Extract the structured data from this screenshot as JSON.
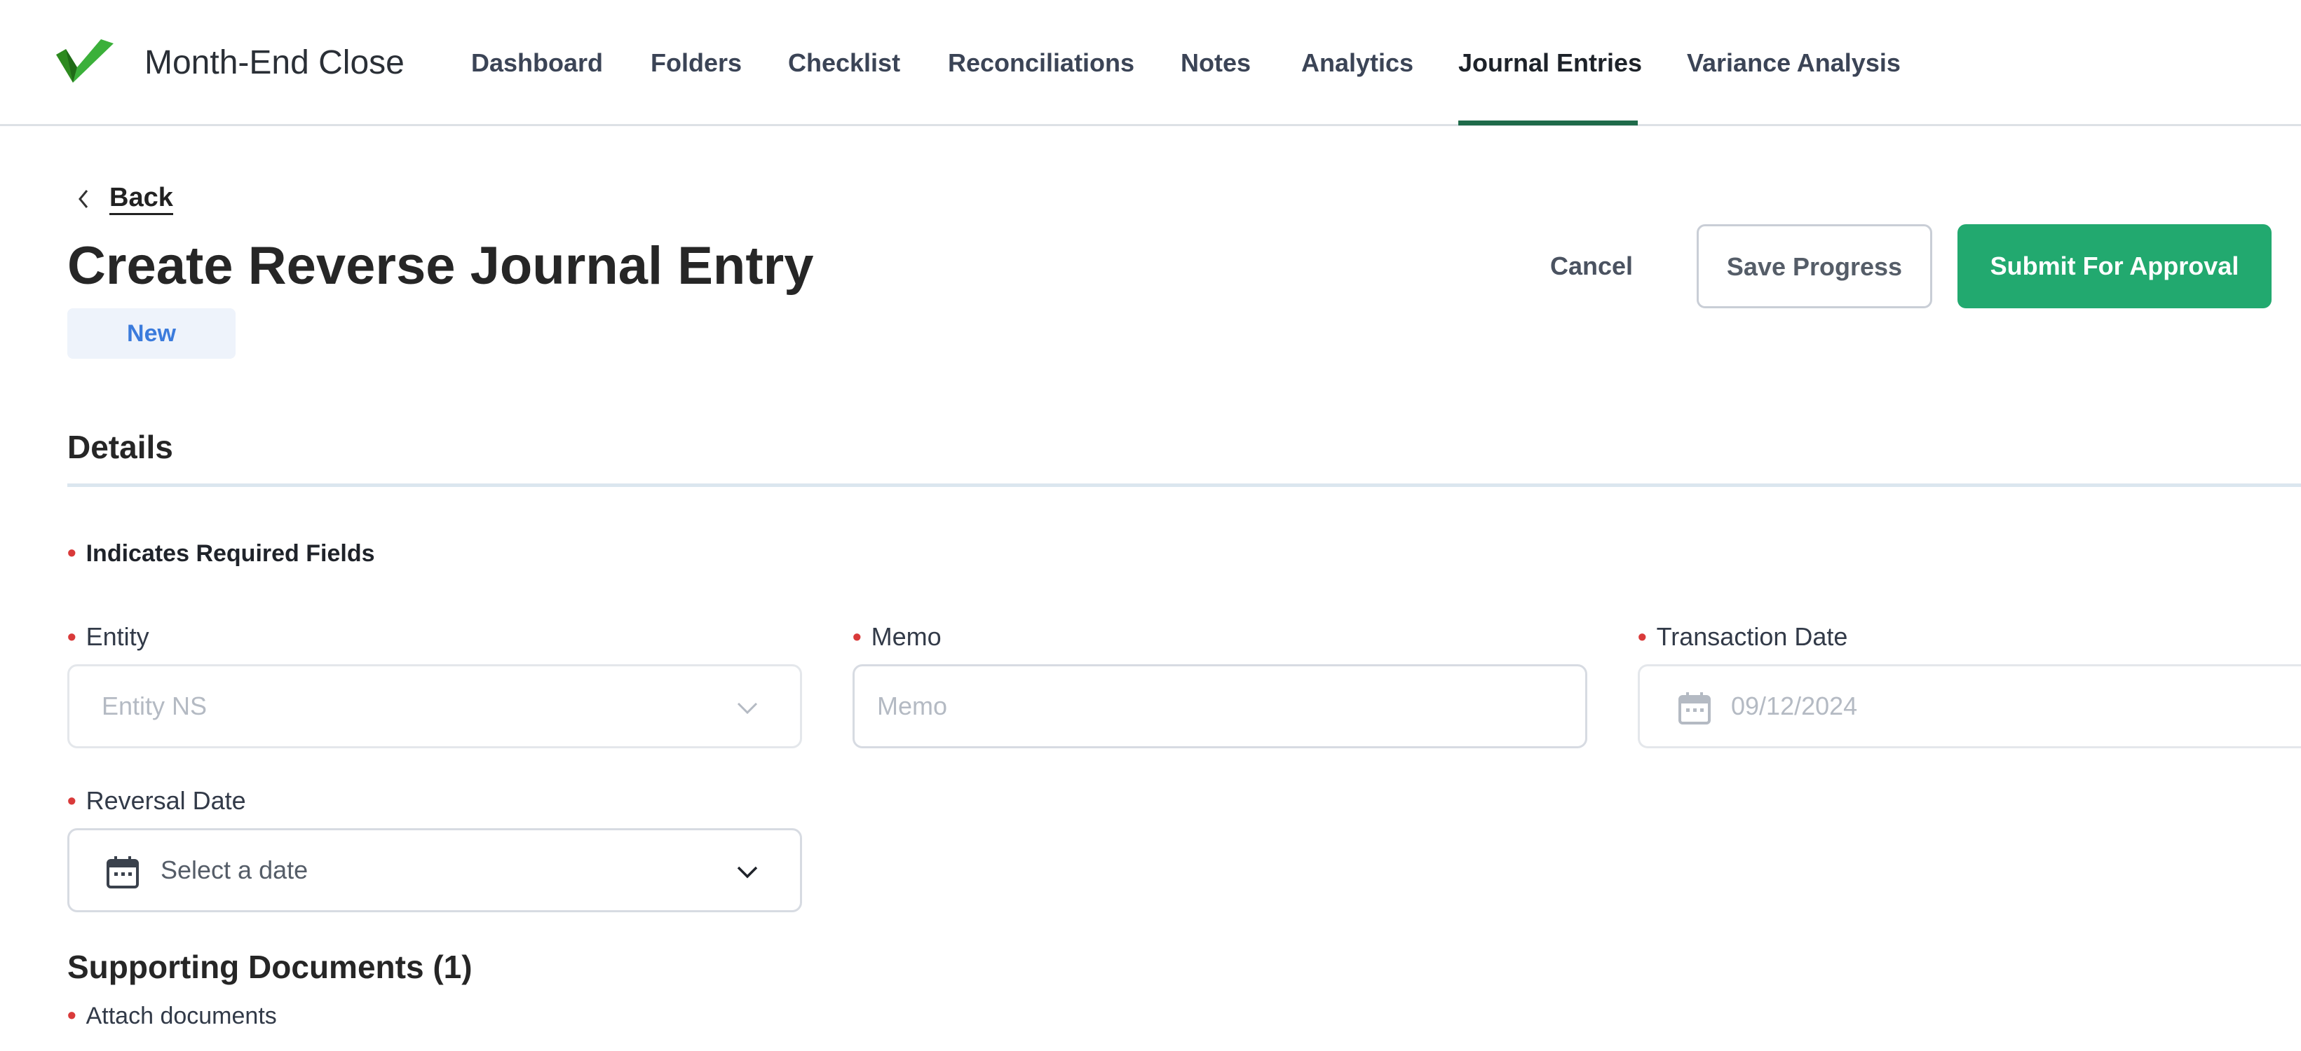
{
  "app": {
    "title": "Month-End Close",
    "logo": "checkmark-logo",
    "accent_color": "#22a96f",
    "nav_underline_color": "#1f6b4a"
  },
  "nav": {
    "items": [
      {
        "label": "Dashboard"
      },
      {
        "label": "Folders"
      },
      {
        "label": "Checklist"
      },
      {
        "label": "Reconciliations"
      },
      {
        "label": "Notes"
      },
      {
        "label": "Analytics"
      },
      {
        "label": "Journal Entries",
        "active": true
      },
      {
        "label": "Variance Analysis"
      }
    ]
  },
  "page": {
    "back_label": "Back",
    "title": "Create Reverse Journal Entry",
    "status": "New",
    "status_color": "#3b7bdc"
  },
  "actions": {
    "cancel": "Cancel",
    "save": "Save Progress",
    "submit": "Submit For Approval"
  },
  "details": {
    "section_title": "Details",
    "required_note": "Indicates Required Fields",
    "required_marker": "•",
    "required_color": "#d93a3a",
    "entity": {
      "label": "Entity",
      "value": "Entity NS",
      "icon": "chevron-down-icon",
      "disabled": true
    },
    "memo": {
      "label": "Memo",
      "placeholder": "Memo",
      "value": ""
    },
    "transaction_date": {
      "label": "Transaction Date",
      "value": "09/12/2024",
      "icon": "calendar-icon",
      "disabled": true
    },
    "reversal_date": {
      "label": "Reversal Date",
      "placeholder": "Select a date",
      "icon": "calendar-icon"
    }
  },
  "documents": {
    "title": "Supporting Documents (1)",
    "attach_label": "Attach documents"
  }
}
